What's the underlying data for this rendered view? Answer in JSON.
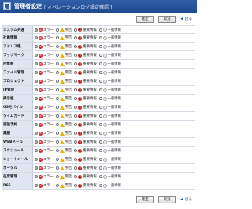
{
  "header": {
    "title": "管理者設定",
    "subtitle": "[ オペレーションログ設定確認 ]"
  },
  "buttons": {
    "confirm": "確定",
    "cancel": "取消",
    "back": "戻る"
  },
  "options": {
    "error": "エラー",
    "warning": "警告",
    "important": "重要情報",
    "info": "一般情報"
  },
  "rows": [
    {
      "label": "システム共通"
    },
    {
      "label": "社員情報"
    },
    {
      "label": "アドレス帳"
    },
    {
      "label": "ブックマーク"
    },
    {
      "label": "回覧板"
    },
    {
      "label": "ファイル管理"
    },
    {
      "label": "プロジェクト"
    },
    {
      "label": "IP管理"
    },
    {
      "label": "掲示板"
    },
    {
      "label": "GSモバイル"
    },
    {
      "label": "タイムカード"
    },
    {
      "label": "施設予約"
    },
    {
      "label": "稟議"
    },
    {
      "label": "WEBメール"
    },
    {
      "label": "スケジュール"
    },
    {
      "label": "ショートメール"
    },
    {
      "label": "ポータル"
    },
    {
      "label": "在席管理"
    },
    {
      "label": "RSS"
    }
  ],
  "colors": {
    "header_bg": "#1e4a8e",
    "label_bg": "#dfe6f2",
    "error": "#d8262c",
    "warning": "#e8b400"
  }
}
